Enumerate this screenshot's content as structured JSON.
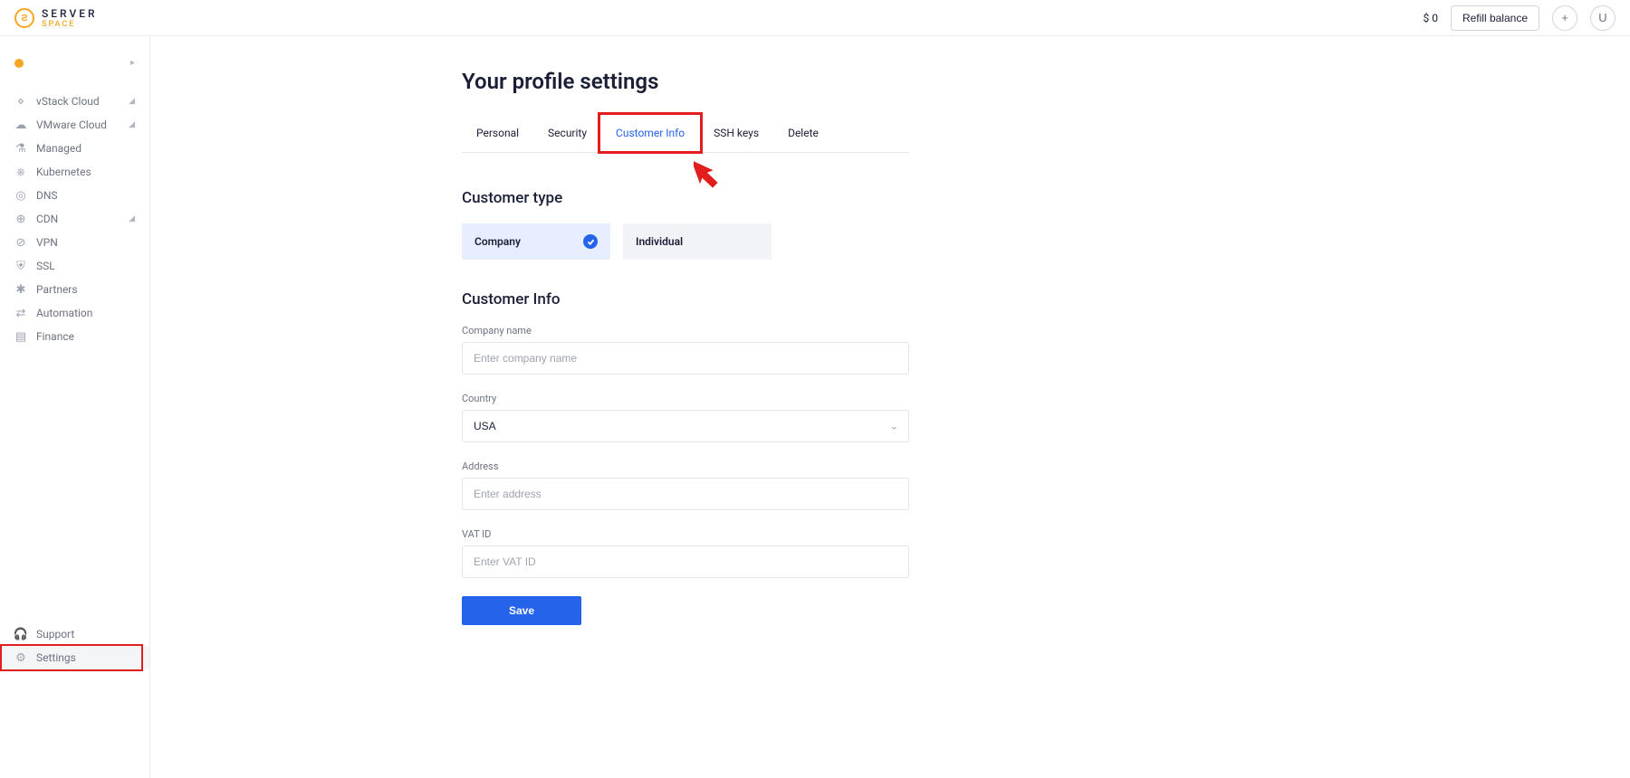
{
  "header": {
    "logo": {
      "line1": "SERVER",
      "line2": "SPACE"
    },
    "balance": "$ 0",
    "refill_label": "Refill balance",
    "user_initial": "U"
  },
  "sidebar": {
    "items": [
      {
        "icon": "⋄",
        "label": "vStack Cloud",
        "expandable": true
      },
      {
        "icon": "☁",
        "label": "VMware Cloud",
        "expandable": true
      },
      {
        "icon": "⚗",
        "label": "Managed",
        "expandable": false
      },
      {
        "icon": "⎈",
        "label": "Kubernetes",
        "expandable": false
      },
      {
        "icon": "◎",
        "label": "DNS",
        "expandable": false
      },
      {
        "icon": "⊕",
        "label": "CDN",
        "expandable": true
      },
      {
        "icon": "⊘",
        "label": "VPN",
        "expandable": false
      },
      {
        "icon": "⛨",
        "label": "SSL",
        "expandable": false
      },
      {
        "icon": "✱",
        "label": "Partners",
        "expandable": false
      },
      {
        "icon": "⇄",
        "label": "Automation",
        "expandable": false
      },
      {
        "icon": "▤",
        "label": "Finance",
        "expandable": false
      }
    ],
    "bottom": [
      {
        "icon": "🎧",
        "label": "Support"
      },
      {
        "icon": "⚙",
        "label": "Settings"
      }
    ]
  },
  "main": {
    "title": "Your profile settings",
    "tabs": [
      "Personal",
      "Security",
      "Customer Info",
      "SSH keys",
      "Delete"
    ],
    "active_tab_index": 2,
    "section_customer_type": "Customer type",
    "customer_types": [
      "Company",
      "Individual"
    ],
    "selected_type_index": 0,
    "section_customer_info": "Customer Info",
    "form": {
      "company_name": {
        "label": "Company name",
        "placeholder": "Enter company name",
        "value": ""
      },
      "country": {
        "label": "Country",
        "value": "USA"
      },
      "address": {
        "label": "Address",
        "placeholder": "Enter address",
        "value": ""
      },
      "vat_id": {
        "label": "VAT ID",
        "placeholder": "Enter VAT ID",
        "value": ""
      }
    },
    "save_label": "Save"
  },
  "annotations": {
    "highlight_tab": true,
    "highlight_settings": true
  }
}
